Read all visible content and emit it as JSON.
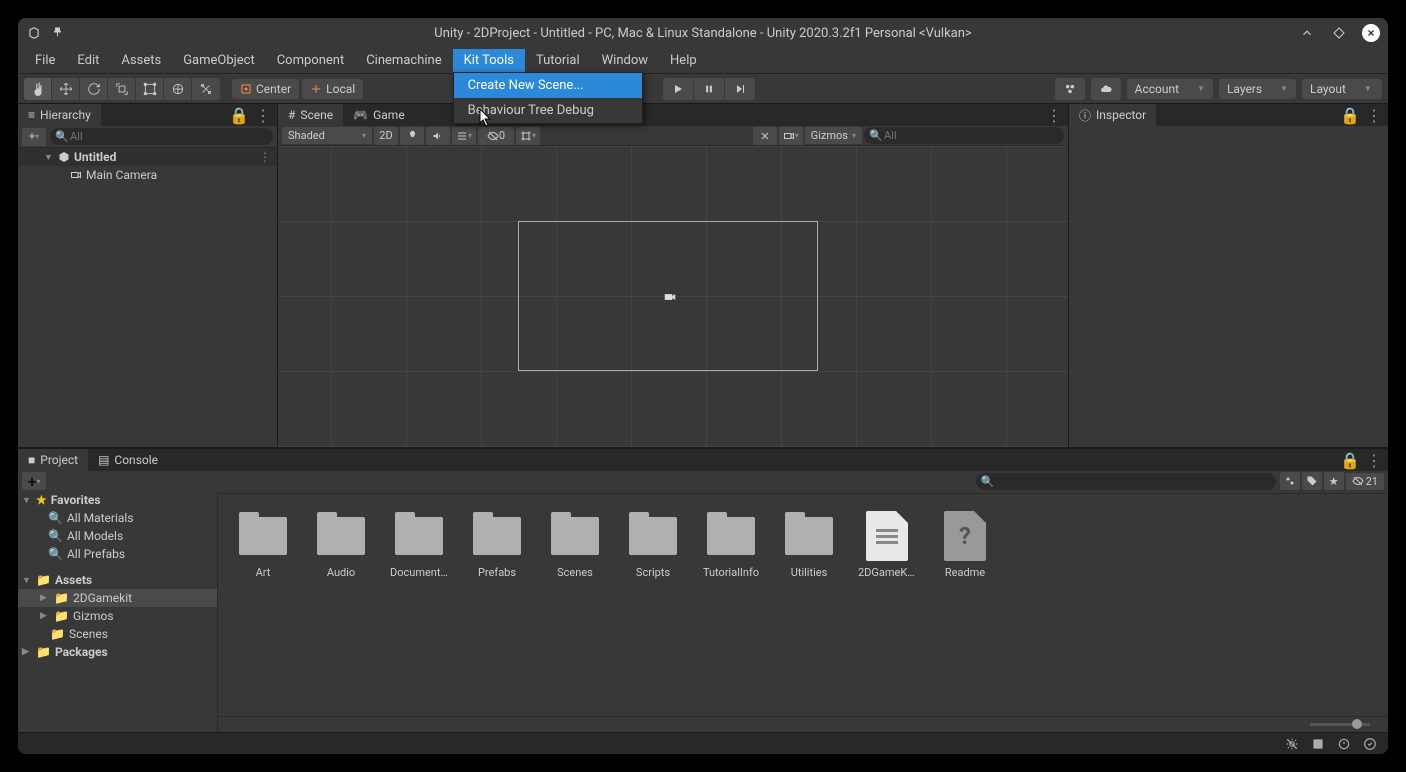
{
  "window": {
    "title": "Unity - 2DProject - Untitled - PC, Mac & Linux Standalone - Unity 2020.3.2f1 Personal <Vulkan>"
  },
  "menubar": {
    "items": [
      "File",
      "Edit",
      "Assets",
      "GameObject",
      "Component",
      "Cinemachine",
      "Kit Tools",
      "Tutorial",
      "Window",
      "Help"
    ],
    "active_index": 6,
    "dropdown": {
      "items": [
        "Create New Scene...",
        "Behaviour Tree Debug"
      ],
      "highlighted_index": 0
    }
  },
  "toolbar": {
    "pivot_center": "Center",
    "pivot_local": "Local",
    "account": "Account",
    "layers": "Layers",
    "layout": "Layout"
  },
  "hierarchy": {
    "tab": "Hierarchy",
    "search_placeholder": "All",
    "root": "Untitled",
    "children": [
      "Main Camera"
    ]
  },
  "scene": {
    "tabs": [
      "Scene",
      "Game"
    ],
    "shading": "Shaded",
    "mode_2d": "2D",
    "gizmos": "Gizmos",
    "visibility_count": "0",
    "search_placeholder": "All"
  },
  "inspector": {
    "tab": "Inspector"
  },
  "project": {
    "tabs": [
      "Project",
      "Console"
    ],
    "search_placeholder": "",
    "hidden_count": "21",
    "breadcrumb": [
      "Assets",
      "2DGamekit"
    ],
    "tree": {
      "favorites": {
        "label": "Favorites",
        "items": [
          "All Materials",
          "All Models",
          "All Prefabs"
        ]
      },
      "assets": {
        "label": "Assets",
        "items": [
          "2DGamekit",
          "Gizmos",
          "Scenes"
        ],
        "selected": "2DGamekit"
      },
      "packages": {
        "label": "Packages"
      }
    },
    "assets": [
      {
        "name": "Art",
        "type": "folder"
      },
      {
        "name": "Audio",
        "type": "folder"
      },
      {
        "name": "Document...",
        "type": "folder"
      },
      {
        "name": "Prefabs",
        "type": "folder"
      },
      {
        "name": "Scenes",
        "type": "folder"
      },
      {
        "name": "Scripts",
        "type": "folder"
      },
      {
        "name": "TutorialInfo",
        "type": "folder"
      },
      {
        "name": "Utilities",
        "type": "folder"
      },
      {
        "name": "2DGameKi...",
        "type": "file-text"
      },
      {
        "name": "Readme",
        "type": "file-question"
      }
    ]
  }
}
